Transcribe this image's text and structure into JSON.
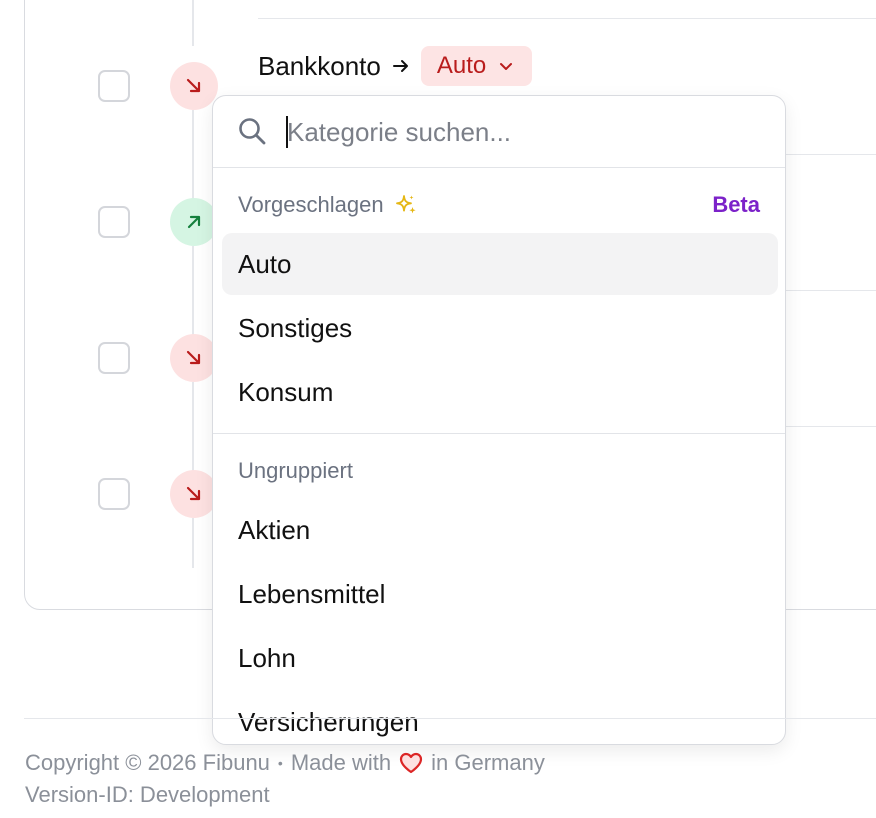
{
  "transaction": {
    "from_account": "Bankkonto",
    "category_chip": "Auto"
  },
  "category_picker": {
    "search_placeholder": "Kategorie suchen...",
    "suggested_heading": "Vorgeschlagen",
    "beta_label": "Beta",
    "suggested_items": [
      "Auto",
      "Sonstiges",
      "Konsum"
    ],
    "ungrouped_heading": "Ungruppiert",
    "ungrouped_items": [
      "Aktien",
      "Lebensmittel",
      "Lohn",
      "Versicherungen"
    ]
  },
  "footer": {
    "copyright": "Copyright © 2026 Fibunu",
    "separator": "•",
    "made_with": "Made with",
    "in_germany": "in Germany",
    "version": "Version-ID: Development"
  },
  "colors": {
    "outgoing": "#b91c1c",
    "outgoing_bg": "#fde1e1",
    "incoming": "#15803d",
    "incoming_bg": "#d5f5e3",
    "beta": "#7c22c9",
    "sparkle": "#e5b714",
    "heart": "#dc2626"
  },
  "icons": {
    "search": "search-icon",
    "sparkle": "sparkle-icon",
    "outgoing": "arrow-down-right-icon",
    "incoming": "arrow-up-right-icon",
    "heart": "heart-icon",
    "chevron": "chevron-down-icon"
  }
}
